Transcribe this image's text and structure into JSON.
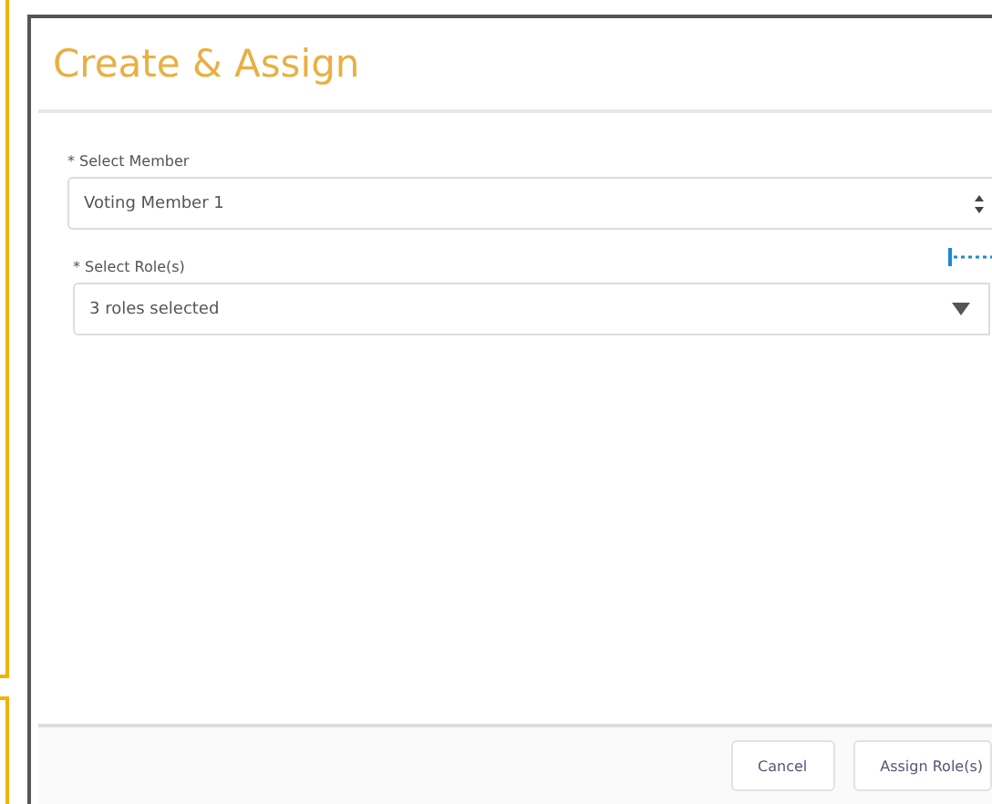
{
  "dialog": {
    "title": "Create & Assign",
    "fields": [
      {
        "kind": "spinner",
        "label": "* Select Member",
        "value": "Voting Member 1"
      },
      {
        "kind": "dropdown",
        "label": "* Select Role(s)",
        "value": "3 roles selected"
      }
    ],
    "buttons": [
      "Cancel",
      "Assign Role(s)"
    ]
  }
}
